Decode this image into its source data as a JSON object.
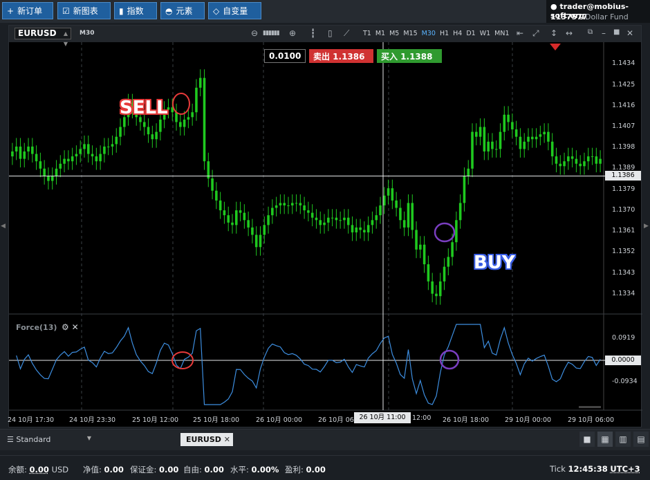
{
  "toolbar": {
    "buttons": [
      {
        "icon": "plus-icon",
        "label": "新订单"
      },
      {
        "icon": "new-chart-icon",
        "label": "新图表"
      },
      {
        "icon": "indicator-icon",
        "label": "指数"
      },
      {
        "icon": "element-icon",
        "label": "元素"
      },
      {
        "icon": "variable-icon",
        "label": "自变量"
      }
    ]
  },
  "account": {
    "user": "trader@mobius-soft.org",
    "number": "1137577",
    "fund": "Dollar Fund"
  },
  "chart": {
    "symbol": "EURUSD",
    "timeframe_label": "M30",
    "timeframes": [
      "T1",
      "M1",
      "M5",
      "M15",
      "M30",
      "H1",
      "H4",
      "D1",
      "W1",
      "MN1"
    ],
    "active_timeframe": "M30",
    "lot_value": "0.0100",
    "sell_label": "卖出 1.1386",
    "buy_label": "买入 1.1388",
    "annotations": {
      "sell": "SELL",
      "buy": "BUY"
    },
    "price_axis": [
      "1.1434",
      "1.1425",
      "1.1416",
      "1.1407",
      "1.1398",
      "1.1389",
      "1.1379",
      "1.1370",
      "1.1361",
      "1.1352",
      "1.1343",
      "1.1334"
    ],
    "current_price": "1.1386",
    "indicator": {
      "name": "Force(13)",
      "axis": [
        "0.0919",
        "0.0000",
        "-0.0934"
      ],
      "current": "0.0000"
    },
    "time_axis": [
      "24 10月 17:30",
      "24 10月 23:30",
      "25 10月 12:00",
      "25 10月 18:00",
      "26 10月 00:00",
      "26 10月 06",
      "12:00",
      "26 10月 18:00",
      "29 10月 00:00",
      "29 10月 06:00"
    ],
    "crosshair_time": "26 10月 11:00",
    "colors": {
      "up": "#1fc91f",
      "down": "#1fc91f",
      "force_line": "#3d8ee0",
      "sell_circle": "#e83a3a",
      "buy_circle": "#7a3ec0"
    }
  },
  "chart_data": {
    "type": "candlestick",
    "symbol": "EURUSD",
    "timeframe": "M30",
    "ylim": [
      1.133,
      1.144
    ],
    "close": [
      1.1396,
      1.1398,
      1.1393,
      1.1396,
      1.1398,
      1.1395,
      1.1392,
      1.1389,
      1.1386,
      1.1384,
      1.1386,
      1.1389,
      1.1391,
      1.1393,
      1.1392,
      1.1394,
      1.1395,
      1.1397,
      1.1399,
      1.1395,
      1.1394,
      1.1392,
      1.1395,
      1.1398,
      1.1398,
      1.1399,
      1.1402,
      1.1406,
      1.141,
      1.1416,
      1.1413,
      1.141,
      1.1408,
      1.1406,
      1.1403,
      1.1401,
      1.1404,
      1.1409,
      1.1413,
      1.1414,
      1.1412,
      1.1408,
      1.1406,
      1.1409,
      1.141,
      1.1412,
      1.1422,
      1.1426,
      1.1392,
      1.1385,
      1.138,
      1.1376,
      1.1372,
      1.137,
      1.1367,
      1.1366,
      1.1372,
      1.1371,
      1.1368,
      1.1365,
      1.1362,
      1.1357,
      1.1362,
      1.1366,
      1.137,
      1.1373,
      1.1374,
      1.1375,
      1.1374,
      1.1374,
      1.1375,
      1.1375,
      1.1374,
      1.1372,
      1.1371,
      1.1369,
      1.1368,
      1.1366,
      1.1367,
      1.1369,
      1.1369,
      1.1368,
      1.1368,
      1.1369,
      1.1366,
      1.1363,
      1.1365,
      1.1364,
      1.1363,
      1.1366,
      1.1368,
      1.137,
      1.1374,
      1.1378,
      1.1381,
      1.1376,
      1.1373,
      1.1368,
      1.1365,
      1.1375,
      1.1364,
      1.1356,
      1.1358,
      1.135,
      1.1343,
      1.1338,
      1.1337,
      1.1343,
      1.1349,
      1.1353,
      1.1359,
      1.1368,
      1.1375,
      1.1386,
      1.1389,
      1.1404,
      1.1402,
      1.1406,
      1.1396,
      1.14,
      1.1397,
      1.1397,
      1.1404,
      1.1411,
      1.1408,
      1.1405,
      1.1402,
      1.1397,
      1.14,
      1.1402,
      1.1401,
      1.1402,
      1.1403,
      1.1404,
      1.14,
      1.1394,
      1.1391,
      1.139,
      1.1392,
      1.1394,
      1.1393,
      1.1391,
      1.139,
      1.1392,
      1.1394,
      1.1394,
      1.1391,
      1.1393
    ]
  },
  "layout_tab": {
    "name": "Standard",
    "symbol_tab": "EURUSD"
  },
  "status": {
    "balance_label": "余额:",
    "balance": "0.00",
    "currency": "USD",
    "equity_label": "净值:",
    "equity": "0.00",
    "margin_label": "保证金:",
    "margin": "0.00",
    "free_label": "自由:",
    "free": "0.00",
    "level_label": "水平:",
    "level": "0.00%",
    "profit_label": "盈利:",
    "profit": "0.00",
    "tick_label": "Tick",
    "time": "12:45:38",
    "tz": "UTC+3"
  }
}
